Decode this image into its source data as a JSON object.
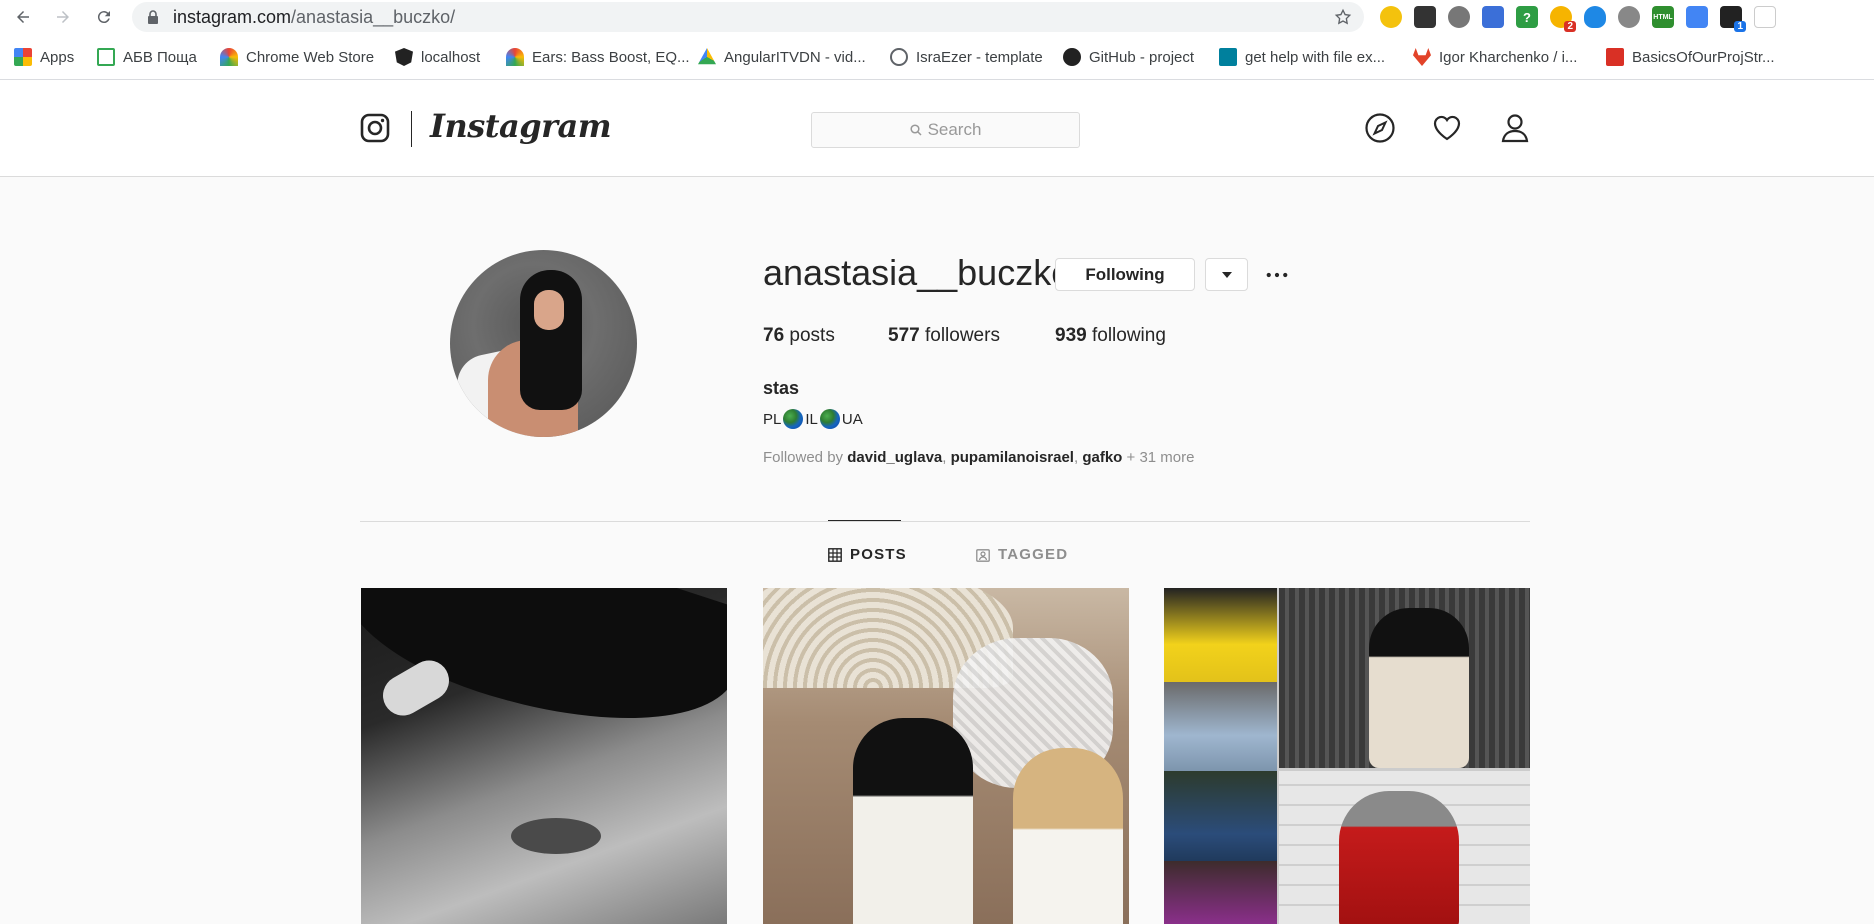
{
  "browser": {
    "url_domain": "instagram.com",
    "url_path": "/anastasia__buczko/",
    "bookmarks": [
      {
        "label": "Apps",
        "icon": "apps-grid-icon"
      },
      {
        "label": "АБВ Поща",
        "icon": "home-icon"
      },
      {
        "label": "Chrome Web Store",
        "icon": "rainbow-icon"
      },
      {
        "label": "localhost",
        "icon": "angular-icon"
      },
      {
        "label": "Ears: Bass Boost, EQ...",
        "icon": "rainbow-icon"
      },
      {
        "label": "AngularITVDN - vid...",
        "icon": "drive-icon"
      },
      {
        "label": "IsraEzer - template",
        "icon": "globe-icon"
      },
      {
        "label": "GitHub - project",
        "icon": "github-icon"
      },
      {
        "label": "get help with file ex...",
        "icon": "bing-icon"
      },
      {
        "label": "Igor Kharchenko / i...",
        "icon": "gitlab-icon"
      },
      {
        "label": "BasicsOfOurProjStr...",
        "icon": "slides-icon"
      }
    ],
    "extension_badges": {
      "bulb": "2",
      "package": "1"
    },
    "extension_html_label": "HTML"
  },
  "header": {
    "wordmark": "Instagram",
    "search_placeholder": "Search"
  },
  "profile": {
    "username": "anastasia__buczko",
    "following_label": "Following",
    "posts_count": "76",
    "posts_label": "posts",
    "followers_count": "577",
    "followers_label": "followers",
    "following_count": "939",
    "following_stat_label": "following",
    "full_name": "stas",
    "bio_parts": [
      "PL",
      "IL",
      "UA"
    ],
    "followed_by_prefix": "Followed by",
    "followed_by_accounts": [
      "david_uglava",
      "pupamilanoisrael",
      "gafko"
    ],
    "followed_by_more": "+ 31 more"
  },
  "tabs": {
    "posts": "POSTS",
    "tagged": "TAGGED"
  },
  "colors": {
    "text": "#262626",
    "muted": "#8e8e8e",
    "border": "#dbdbdb",
    "background": "#fafafa"
  }
}
